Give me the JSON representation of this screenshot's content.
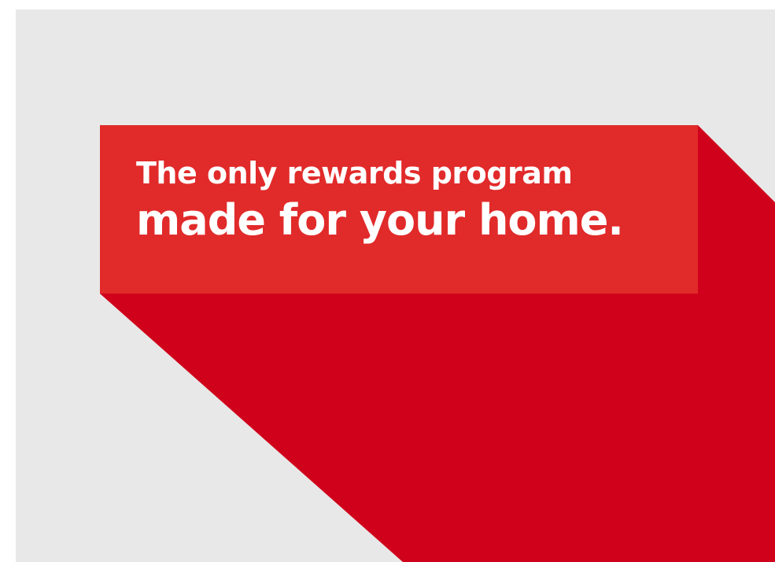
{
  "headline": {
    "line1": "The only rewards program",
    "line2": "made for your home."
  },
  "colors": {
    "background": "#e8e8e8",
    "banner": "#e12a2a",
    "shadow": "#d0021b",
    "text": "#ffffff"
  }
}
